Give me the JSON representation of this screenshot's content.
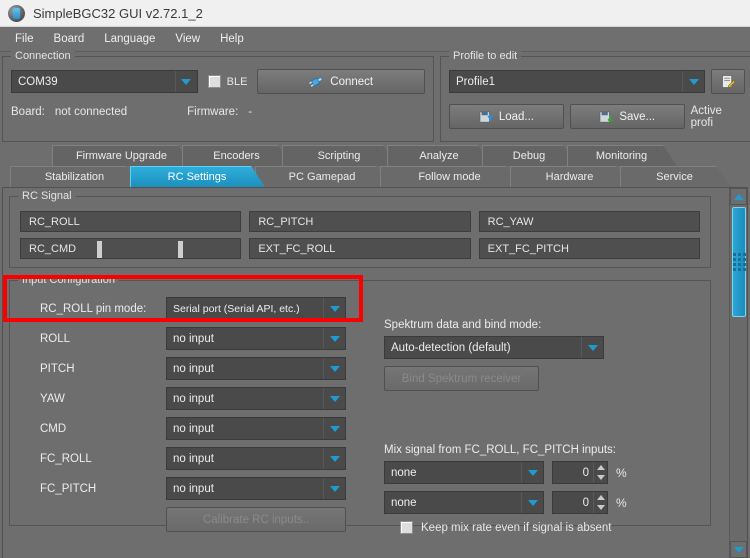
{
  "window": {
    "title": "SimpleBGC32 GUI v2.72.1_2",
    "icon": "app-logo-icon"
  },
  "menubar": {
    "items": [
      "File",
      "Board",
      "Language",
      "View",
      "Help"
    ]
  },
  "connection": {
    "group_title": "Connection",
    "port": {
      "value": "COM39"
    },
    "ble": {
      "label": "BLE",
      "checked": false
    },
    "connect_button": {
      "label": "Connect",
      "icon": "plug-icon"
    },
    "board_label": "Board:",
    "board_value": "not connected",
    "firmware_label": "Firmware:",
    "firmware_value": "-"
  },
  "profile": {
    "group_title": "Profile to edit",
    "selected": "Profile1",
    "edit_button_icon": "edit-profile-icon",
    "load_button": {
      "label": "Load...",
      "icon": "load-icon"
    },
    "save_button": {
      "label": "Save...",
      "icon": "save-icon"
    },
    "active_profile_label": "Active profi"
  },
  "tabs": {
    "top_row": [
      "Firmware Upgrade",
      "Encoders",
      "Scripting",
      "Analyze",
      "Debug",
      "Monitoring"
    ],
    "bottom_row": [
      "Stabilization",
      "RC Settings",
      "PC Gamepad",
      "Follow mode",
      "Hardware",
      "Service"
    ],
    "active": "RC Settings"
  },
  "rc_signal": {
    "group_title": "RC Signal",
    "bars": [
      [
        "RC_ROLL",
        "RC_PITCH",
        "RC_YAW"
      ],
      [
        "RC_CMD",
        "EXT_FC_ROLL",
        "EXT_FC_PITCH"
      ]
    ]
  },
  "input_configuration": {
    "group_title": "Input Configuration",
    "pin_mode_label": "RC_ROLL pin mode:",
    "pin_mode_value": "Serial port (Serial API, etc.)",
    "channels": [
      {
        "label": "ROLL",
        "value": "no input"
      },
      {
        "label": "PITCH",
        "value": "no input"
      },
      {
        "label": "YAW",
        "value": "no input"
      },
      {
        "label": "CMD",
        "value": "no input"
      },
      {
        "label": "FC_ROLL",
        "value": "no input"
      },
      {
        "label": "FC_PITCH",
        "value": "no input"
      }
    ],
    "calibrate_button": {
      "label": "Calibrate RC inputs..",
      "enabled": false
    }
  },
  "spektrum": {
    "label": "Spektrum data and bind mode:",
    "mode_value": "Auto-detection (default)",
    "bind_button": {
      "label": "Bind Spektrum receiver",
      "enabled": false
    }
  },
  "mix": {
    "label": "Mix signal from FC_ROLL, FC_PITCH inputs:",
    "rows": [
      {
        "source": "none",
        "rate": "0",
        "unit": "%"
      },
      {
        "source": "none",
        "rate": "0",
        "unit": "%"
      }
    ],
    "keep_checkbox": {
      "label": "Keep mix rate even if signal is absent",
      "checked": false
    }
  },
  "highlight": {
    "color": "#fb0000"
  },
  "colors": {
    "accent": "#1d8fbd",
    "panel": "#6e6e6e",
    "field": "#4a4a4a"
  }
}
